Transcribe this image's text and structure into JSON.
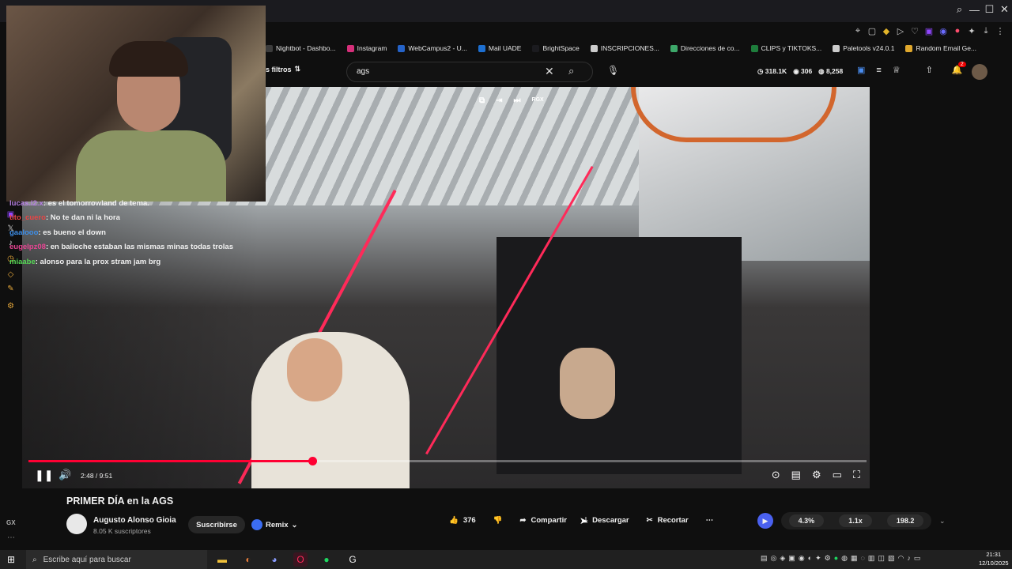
{
  "browser": {
    "window_controls": [
      "⌕",
      "—",
      "☐",
      "✕"
    ],
    "bookmarks": [
      {
        "label": "Nightbot - Dashbo...",
        "color": "#3c3c3c"
      },
      {
        "label": "Instagram",
        "color": "#d62f7a"
      },
      {
        "label": "WebCampus2 - U...",
        "color": "#2563c9"
      },
      {
        "label": "Mail UADE",
        "color": "#1d6fd1"
      },
      {
        "label": "BrightSpace",
        "color": "#1b1b1f"
      },
      {
        "label": "INSCRIPCIONES...",
        "color": "#cccccc"
      },
      {
        "label": "Direcciones de co...",
        "color": "#3da86a"
      },
      {
        "label": "CLIPS y TIKTOKS...",
        "color": "#1e7d3c"
      },
      {
        "label": "Paletools v24.0.1",
        "color": "#cccccc"
      },
      {
        "label": "Random Email Ge...",
        "color": "#e0a82d"
      }
    ]
  },
  "youtube": {
    "filters_label": "s filtros",
    "search_value": "ags",
    "stats": {
      "views": "318.1K",
      "likes": "306",
      "count": "8,258"
    },
    "notification_count": "2"
  },
  "chat": {
    "messages": [
      {
        "user": "lucas.l2.x",
        "user_color": "#b47de0",
        "text": ": es el tomorrowland de tema."
      },
      {
        "user": "tito_cuero",
        "user_color": "#e84545",
        "text": ": No te dan ni la hora"
      },
      {
        "user": "gaalooo",
        "user_color": "#3d8ee8",
        "text": ": es bueno el down"
      },
      {
        "user": "eugelpz08",
        "user_color": "#e84593",
        "text": ": en bailoche estaban las mismas minas todas trolas"
      },
      {
        "user": "miaabe",
        "user_color": "#57d957",
        "text": ": alonso para la prox stram jam brg"
      }
    ]
  },
  "player": {
    "time": "2:48 / 9:51",
    "progress": 0.3384,
    "overlay_label": "RGX"
  },
  "video": {
    "title": "PRIMER DÍA en la AGS",
    "channel_name": "Augusto Alonso Gioia",
    "subscribers": "8.05 K suscriptores",
    "subscribe_label": "Suscribirse",
    "remix_label": "Remix",
    "like_count": "376",
    "share_label": "Compartir",
    "download_label": "Descargar",
    "clip_label": "Recortar"
  },
  "speed_panel": {
    "percent": "4.3%",
    "speed": "1.1x",
    "value": "198.2"
  },
  "sidebar": {
    "gx_label": "GX"
  },
  "taskbar": {
    "search_placeholder": "Escribe aquí para buscar",
    "time": "21:31",
    "date": "12/10/2025"
  }
}
